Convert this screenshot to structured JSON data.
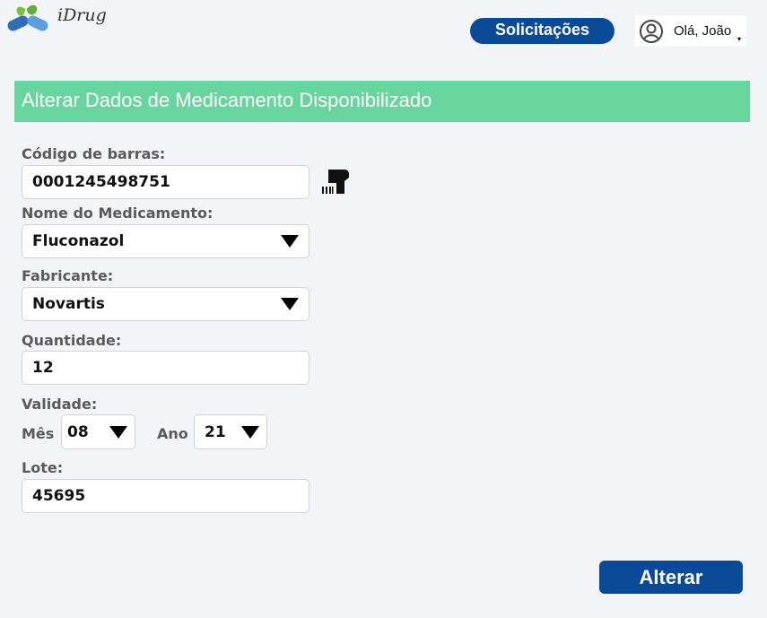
{
  "brand": {
    "name": "iDrug"
  },
  "header": {
    "requests_label": "Solicitações",
    "greeting": "Olá, João",
    "caret": "▾"
  },
  "page": {
    "title": "Alterar Dados de Medicamento Disponibilizado"
  },
  "form": {
    "barcode": {
      "label": "Código de barras:",
      "value": "0001245498751",
      "icon": "barcode-scanner-icon"
    },
    "medicine": {
      "label": "Nome do Medicamento:",
      "value": "Fluconazol"
    },
    "manufacturer": {
      "label": "Fabricante:",
      "value": "Novartis"
    },
    "quantity": {
      "label": "Quantidade:",
      "value": "12"
    },
    "expiry": {
      "label": "Validade:",
      "month_label": "Mês",
      "month_value": "08",
      "year_label": "Ano",
      "year_value": "21"
    },
    "lot": {
      "label": "Lote:",
      "value": "45695"
    }
  },
  "actions": {
    "submit_label": "Alterar"
  },
  "colors": {
    "primary": "#0a4a96",
    "banner": "#68d59f",
    "background": "#f3f4f8"
  }
}
